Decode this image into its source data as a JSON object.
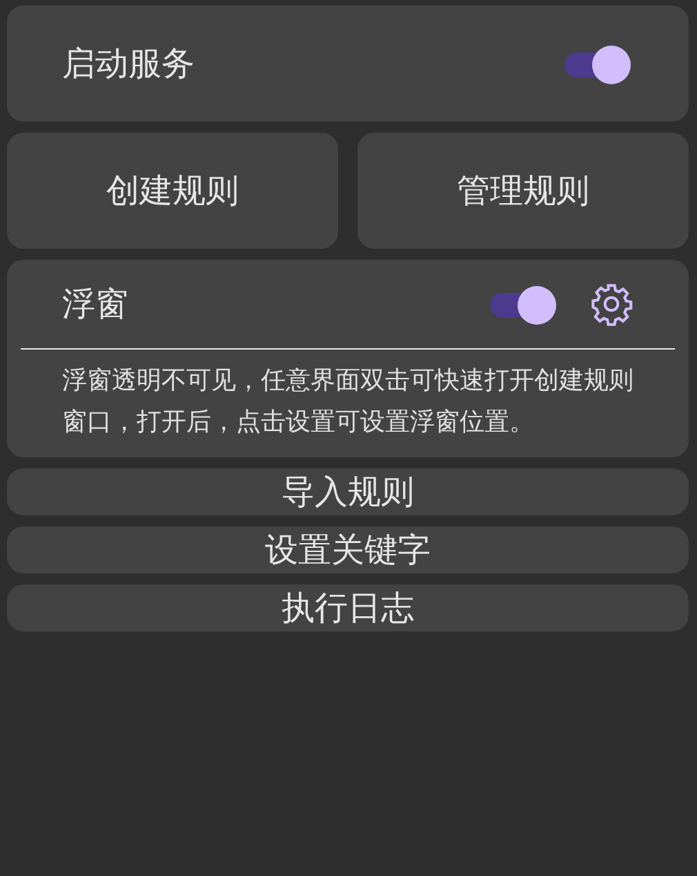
{
  "service": {
    "label": "启动服务",
    "on": true
  },
  "rule_buttons": [
    "创建规则",
    "管理规则"
  ],
  "float_window": {
    "label": "浮窗",
    "on": true,
    "description": "浮窗透明不可见，任意界面双击可快速打开创建规则窗口，打开后，点击设置可设置浮窗位置。"
  },
  "buttons": [
    "导入规则",
    "设置关键字",
    "执行日志"
  ]
}
